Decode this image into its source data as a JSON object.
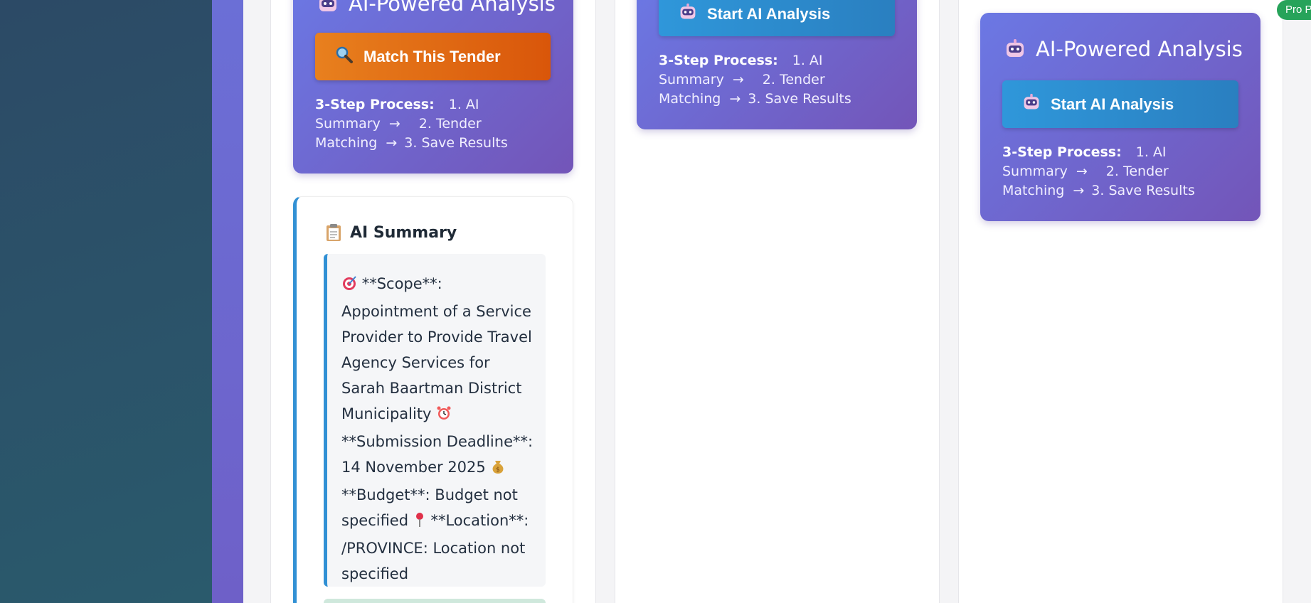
{
  "cards": [
    {
      "title": "AI-Powered Analysis",
      "button_label": "Match This Tender",
      "button_icon": "magnifier-icon",
      "steps_label": "3-Step Process:",
      "step1": "1. AI Summary",
      "step2": "2. Tender Matching",
      "step3": "3. Save Results"
    },
    {
      "button_label": "Start AI Analysis",
      "button_icon": "robot-icon",
      "steps_label": "3-Step Process:",
      "step1": "1. AI Summary",
      "step2": "2. Tender Matching",
      "step3": "3. Save Results"
    },
    {
      "title": "AI-Powered Analysis",
      "button_label": "Start AI Analysis",
      "button_icon": "robot-icon",
      "steps_label": "3-Step Process:",
      "step1": "1. AI Summary",
      "step2": "2. Tender Matching",
      "step3": "3. Save Results"
    }
  ],
  "arrow": "→",
  "summary": {
    "title": "AI Summary",
    "icon": "clipboard-icon",
    "scope": "**Scope**: Appointment of a Service Provider to Provide Travel Agency Services for Sarah Baartman District Municipality",
    "deadline": "**Submission Deadline**: 14 November 2025",
    "budget": "**Budget**: Budget not specified",
    "location": "**Location**: /PROVINCE: Location not specified"
  },
  "badge": "Pro Plan",
  "colors": {
    "card_gradient_start": "#6b78e4",
    "card_gradient_end": "#7355b8",
    "orange_button": "#e06a14",
    "blue_button": "#2d8ccf",
    "summary_accent": "#3190d4",
    "badge_green": "#27a35a",
    "rail": "#2c4a66"
  }
}
